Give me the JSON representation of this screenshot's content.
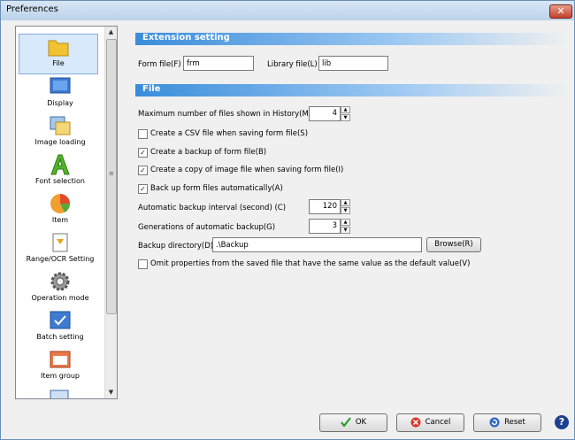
{
  "window": {
    "title": "Preferences",
    "close_glyph": "✕"
  },
  "sidebar": {
    "items": [
      {
        "label": "File",
        "icon": "folder-icon",
        "selected": true
      },
      {
        "label": "Display",
        "icon": "monitor-icon",
        "selected": false
      },
      {
        "label": "Image loading",
        "icon": "image-loading-icon",
        "selected": false
      },
      {
        "label": "Font selection",
        "icon": "font-icon",
        "selected": false
      },
      {
        "label": "Item",
        "icon": "pie-chart-icon",
        "selected": false
      },
      {
        "label": "Range/OCR Setting",
        "icon": "range-ocr-icon",
        "selected": false
      },
      {
        "label": "Operation mode",
        "icon": "gear-icon",
        "selected": false
      },
      {
        "label": "Batch setting",
        "icon": "batch-icon",
        "selected": false
      },
      {
        "label": "Item group",
        "icon": "item-group-icon",
        "selected": false
      }
    ],
    "scroll_up": "▲",
    "scroll_down": "▼",
    "scroll_grip": "≡"
  },
  "extension": {
    "header": "Extension setting",
    "form_file_label": "Form file(F)",
    "form_file_value": "frm",
    "library_file_label": "Library file(L)",
    "library_file_value": "lib"
  },
  "file": {
    "header": "File",
    "history_label": "Maximum number of files shown in History(M)",
    "history_value": "4",
    "csv_label": "Create a CSV file when saving form file(S)",
    "csv_checked": false,
    "backup_form_label": "Create a backup of form file(B)",
    "backup_form_checked": true,
    "copy_image_label": "Create a copy of image file when saving form file(I)",
    "copy_image_checked": true,
    "auto_backup_label": "Back up form files automatically(A)",
    "auto_backup_checked": true,
    "interval_label": "Automatic backup interval (second) (C)",
    "interval_value": "120",
    "generations_label": "Generations of automatic backup(G)",
    "generations_value": "3",
    "backup_dir_label": "Backup directory(D)",
    "backup_dir_value": ".\\Backup",
    "browse_label": "Browse(R)",
    "omit_label": "Omit properties from the saved file that have the same value as the default value(V)",
    "omit_checked": false
  },
  "footer": {
    "ok_label": "OK",
    "cancel_label": "Cancel",
    "reset_label": "Reset",
    "help_glyph": "?"
  },
  "spin": {
    "up": "▲",
    "down": "▼"
  },
  "check_glyph": "✓",
  "colors": {
    "section_bar": "#3a8ddb",
    "selected_item": "#d7e9fb",
    "help": "#1b3f92"
  }
}
